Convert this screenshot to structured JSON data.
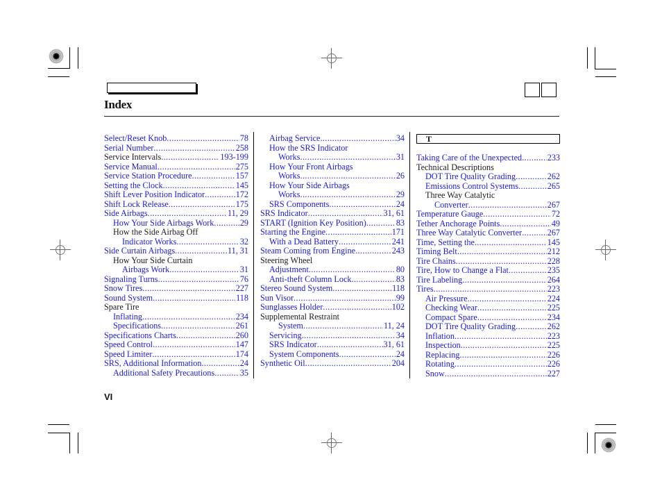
{
  "header": {
    "title": "Index",
    "tab_label": "",
    "nav_buttons": [
      "",
      ""
    ]
  },
  "page_number": "VI",
  "colors": {
    "link": "#1a1adb",
    "text": "#1a1a1a"
  },
  "columns": [
    {
      "entries": [
        {
          "label": "Select/Reset Knob",
          "page": "78",
          "indent": 0,
          "link": true
        },
        {
          "label": "Serial Number",
          "page": "258",
          "indent": 0,
          "link": true
        },
        {
          "label": "Service Intervals",
          "page": "193-199",
          "indent": 0,
          "link": false,
          "page_link": true
        },
        {
          "label": "Service Manual",
          "page": "275",
          "indent": 0,
          "link": true
        },
        {
          "label": "Service Station Procedure",
          "page": "157",
          "indent": 0,
          "link": true
        },
        {
          "label": "Setting the Clock",
          "page": "145",
          "indent": 0,
          "link": true
        },
        {
          "label": "Shift Lever Position Indicator",
          "page": "172",
          "indent": 0,
          "link": true
        },
        {
          "label": "Shift Lock Release",
          "page": "175",
          "indent": 0,
          "link": true
        },
        {
          "label": "Side Airbags",
          "page": "11, 29",
          "indent": 0,
          "link": true
        },
        {
          "label": "How Your Side Airbags Work",
          "page": "29",
          "indent": 1,
          "link": true
        },
        {
          "label": "How the Side Airbag Off",
          "page": "",
          "indent": 1,
          "link": false
        },
        {
          "label": "Indicator Works",
          "page": "32",
          "indent": 2,
          "link": true
        },
        {
          "label": "Side Curtain Airbags",
          "page": "11, 31",
          "indent": 0,
          "link": true
        },
        {
          "label": "How Your Side Curtain",
          "page": "",
          "indent": 1,
          "link": false
        },
        {
          "label": "Airbags Work",
          "page": "31",
          "indent": 2,
          "link": true
        },
        {
          "label": "Signaling Turns",
          "page": "76",
          "indent": 0,
          "link": true
        },
        {
          "label": "Snow Tires",
          "page": "227",
          "indent": 0,
          "link": true
        },
        {
          "label": "Sound System",
          "page": "118",
          "indent": 0,
          "link": true
        },
        {
          "label": "Spare Tire",
          "page": "",
          "indent": 0,
          "link": false
        },
        {
          "label": "Inflating",
          "page": "234",
          "indent": 1,
          "link": true
        },
        {
          "label": "Specifications",
          "page": "261",
          "indent": 1,
          "link": true
        },
        {
          "label": "Specifications Charts",
          "page": "260",
          "indent": 0,
          "link": true
        },
        {
          "label": "Speed Control",
          "page": "147",
          "indent": 0,
          "link": true
        },
        {
          "label": "Speed Limiter",
          "page": "174",
          "indent": 0,
          "link": true
        },
        {
          "label": "SRS, Additional Information",
          "page": "24",
          "indent": 0,
          "link": true
        },
        {
          "label": "Additional Safety Precautions",
          "page": "35",
          "indent": 1,
          "link": true
        }
      ]
    },
    {
      "entries": [
        {
          "label": "Airbag Service",
          "page": "34",
          "indent": 1,
          "link": true
        },
        {
          "label": "How the SRS Indicator",
          "page": "",
          "indent": 1,
          "link": true
        },
        {
          "label": "Works",
          "page": "31",
          "indent": 2,
          "link": true
        },
        {
          "label": "How Your Front Airbags",
          "page": "",
          "indent": 1,
          "link": true
        },
        {
          "label": "Works",
          "page": "26",
          "indent": 2,
          "link": true
        },
        {
          "label": "How Your Side Airbags",
          "page": "",
          "indent": 1,
          "link": true
        },
        {
          "label": "Works",
          "page": "29",
          "indent": 2,
          "link": true
        },
        {
          "label": "SRS Components",
          "page": "24",
          "indent": 1,
          "link": true
        },
        {
          "label": "SRS Indicator",
          "page": "31, 61",
          "indent": 0,
          "link": true
        },
        {
          "label": "START (Ignition Key Position)",
          "page": "83",
          "indent": 0,
          "link": true
        },
        {
          "label": "Starting the Engine",
          "page": "171",
          "indent": 0,
          "link": true
        },
        {
          "label": "With a Dead Battery",
          "page": "241",
          "indent": 1,
          "link": true
        },
        {
          "label": "Steam Coming from Engine",
          "page": "243",
          "indent": 0,
          "link": true
        },
        {
          "label": "Steering Wheel",
          "page": "",
          "indent": 0,
          "link": false
        },
        {
          "label": "Adjustment",
          "page": "80",
          "indent": 1,
          "link": true
        },
        {
          "label": "Anti-theft Column Lock",
          "page": "83",
          "indent": 1,
          "link": true
        },
        {
          "label": "Stereo Sound System",
          "page": "118",
          "indent": 0,
          "link": true
        },
        {
          "label": "Sun Visor",
          "page": "99",
          "indent": 0,
          "link": true
        },
        {
          "label": "Sunglasses Holder",
          "page": "102",
          "indent": 0,
          "link": true
        },
        {
          "label": "Supplemental Restraint",
          "page": "",
          "indent": 0,
          "link": false
        },
        {
          "label": "System",
          "page": "11, 24",
          "indent": 2,
          "link": true
        },
        {
          "label": "Servicing",
          "page": "34",
          "indent": 1,
          "link": true
        },
        {
          "label": "SRS Indicator",
          "page": "31, 61",
          "indent": 1,
          "link": true
        },
        {
          "label": "System Components",
          "page": "24",
          "indent": 1,
          "link": true
        },
        {
          "label": "Synthetic Oil",
          "page": "204",
          "indent": 0,
          "link": true
        }
      ]
    },
    {
      "section_letter": "T",
      "entries": [
        {
          "label": "Taking Care of the Unexpected",
          "page": "233",
          "indent": 0,
          "link": true
        },
        {
          "label": "Technical Descriptions",
          "page": "",
          "indent": 0,
          "link": false
        },
        {
          "label": "DOT Tire Quality Grading",
          "page": "262",
          "indent": 1,
          "link": true
        },
        {
          "label": "Emissions Control Systems",
          "page": "265",
          "indent": 1,
          "link": true
        },
        {
          "label": "Three Way Catalytic",
          "page": "",
          "indent": 1,
          "link": false
        },
        {
          "label": "Converter",
          "page": "267",
          "indent": 2,
          "link": true
        },
        {
          "label": "Temperature Gauge",
          "page": "72",
          "indent": 0,
          "link": true
        },
        {
          "label": "Tether Anchorage Points",
          "page": "49",
          "indent": 0,
          "link": true
        },
        {
          "label": "Three Way Catalytic Converter",
          "page": "267",
          "indent": 0,
          "link": true
        },
        {
          "label": "Time, Setting the",
          "page": "145",
          "indent": 0,
          "link": true
        },
        {
          "label": "Timing Belt",
          "page": "212",
          "indent": 0,
          "link": true
        },
        {
          "label": "Tire Chains",
          "page": "228",
          "indent": 0,
          "link": true
        },
        {
          "label": "Tire, How to Change a Flat",
          "page": "235",
          "indent": 0,
          "link": true
        },
        {
          "label": "Tire Labeling",
          "page": "264",
          "indent": 0,
          "link": true
        },
        {
          "label": "Tires",
          "page": "223",
          "indent": 0,
          "link": true
        },
        {
          "label": "Air Pressure",
          "page": "224",
          "indent": 1,
          "link": true
        },
        {
          "label": "Checking Wear",
          "page": "225",
          "indent": 1,
          "link": true
        },
        {
          "label": "Compact Spare",
          "page": "234",
          "indent": 1,
          "link": true
        },
        {
          "label": "DOT Tire Quality Grading",
          "page": "262",
          "indent": 1,
          "link": true
        },
        {
          "label": "Inflation",
          "page": "223",
          "indent": 1,
          "link": true
        },
        {
          "label": "Inspection",
          "page": "225",
          "indent": 1,
          "link": true
        },
        {
          "label": "Replacing",
          "page": "226",
          "indent": 1,
          "link": true
        },
        {
          "label": "Rotating",
          "page": "226",
          "indent": 1,
          "link": true
        },
        {
          "label": "Snow",
          "page": "227",
          "indent": 1,
          "link": true
        }
      ]
    }
  ]
}
